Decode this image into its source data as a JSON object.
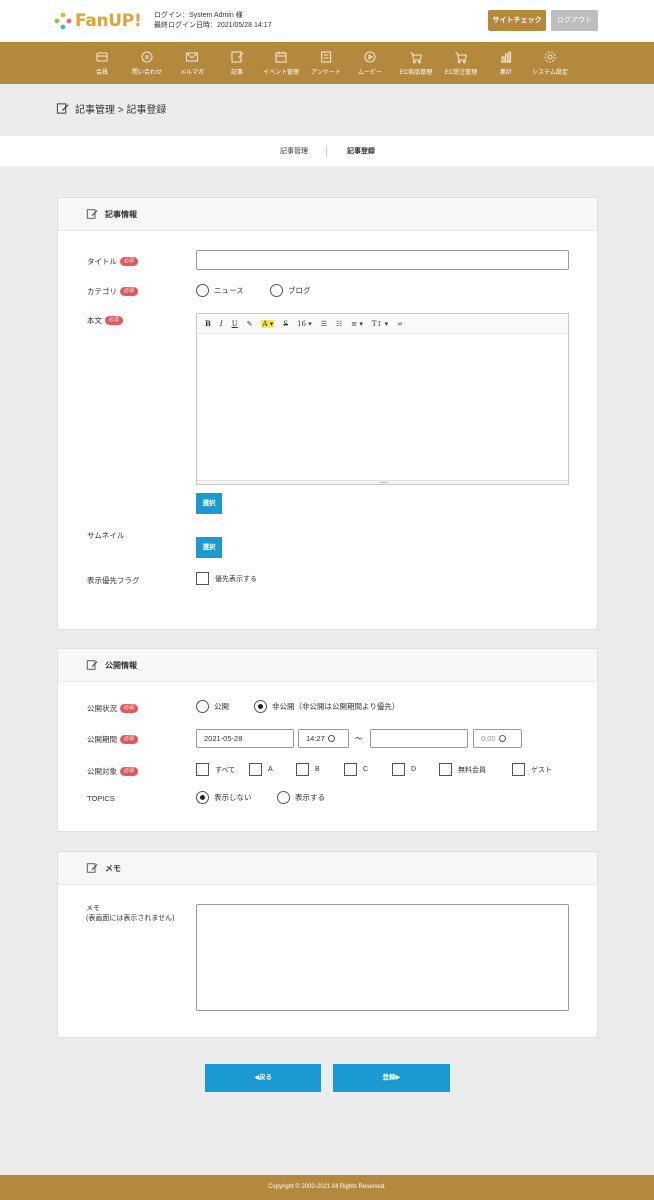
{
  "brand": {
    "name": "FanUP!",
    "accent": "#b4893e",
    "logo_colors": [
      "#e8b33a",
      "#e86a7a",
      "#4fb3d9",
      "#8bc34a"
    ]
  },
  "header": {
    "login_line": "ログイン：System Admin 様",
    "last_login_line": "最終ログイン日時：2021/05/28 14:17",
    "site_check_label": "サイトチェック",
    "logout_label": "ログアウト"
  },
  "nav": [
    {
      "label": "会員",
      "icon": "members-icon"
    },
    {
      "label": "問い合わせ",
      "icon": "inquiry-icon"
    },
    {
      "label": "メルマガ",
      "icon": "mail-icon"
    },
    {
      "label": "記事",
      "icon": "article-icon"
    },
    {
      "label": "イベント管理",
      "icon": "calendar-icon"
    },
    {
      "label": "アンケート",
      "icon": "survey-icon"
    },
    {
      "label": "ムービー",
      "icon": "play-icon"
    },
    {
      "label": "EC商品管理",
      "icon": "cart-icon"
    },
    {
      "label": "EC受注管理",
      "icon": "cart-icon"
    },
    {
      "label": "集計",
      "icon": "chart-icon"
    },
    {
      "label": "システム設定",
      "icon": "gear-icon"
    }
  ],
  "breadcrumb": "記事管理 > 記事登録",
  "tabs": [
    {
      "label": "記事管理",
      "active": false
    },
    {
      "label": "記事登録",
      "active": true
    }
  ],
  "article_card": {
    "title": "記事情報",
    "required_badge": "必須",
    "title_label": "タイトル",
    "title_value": "",
    "category_label": "カテゴリ",
    "category_options": [
      "ニュース",
      "ブログ"
    ],
    "body_label": "本文",
    "toolbar": [
      "B",
      "I",
      "U",
      "✎",
      "A ▾",
      "S",
      "16 ▾",
      "☰",
      "☷",
      "≡ ▾",
      "T↕ ▾",
      "∞"
    ],
    "select_button": "選択",
    "thumbnail_label": "サムネイル",
    "thumbnail_button": "選択",
    "priority_label": "表示優先フラグ",
    "priority_option": "優先表示する"
  },
  "publish_card": {
    "title": "公開情報",
    "status_label": "公開状況",
    "status_options": [
      {
        "label": "公開",
        "checked": false
      },
      {
        "label": "非公開（非公開は公開期間より優先）",
        "checked": true
      }
    ],
    "period_label": "公開期間",
    "start_date": "2021-05-28",
    "start_time": "14:27",
    "range_sep": "〜",
    "end_date": "",
    "end_time": "0:00",
    "target_label": "公開対象",
    "targets": [
      "すべて",
      "A",
      "B",
      "C",
      "D",
      "無料会員",
      "ゲスト"
    ],
    "topics_label": "TOPICS",
    "topics_options": [
      {
        "label": "表示しない",
        "checked": true
      },
      {
        "label": "表示する",
        "checked": false
      }
    ]
  },
  "memo_card": {
    "title": "メモ",
    "memo_label": "メモ",
    "memo_sublabel": "(表画面には表示されません)",
    "memo_value": ""
  },
  "actions": {
    "back_label": "◀戻る",
    "submit_label": "登録▶",
    "button_color": "#1a9ad1"
  },
  "footer": {
    "copyright": "Copyright © 2000-2021 All Rights Reserved."
  }
}
